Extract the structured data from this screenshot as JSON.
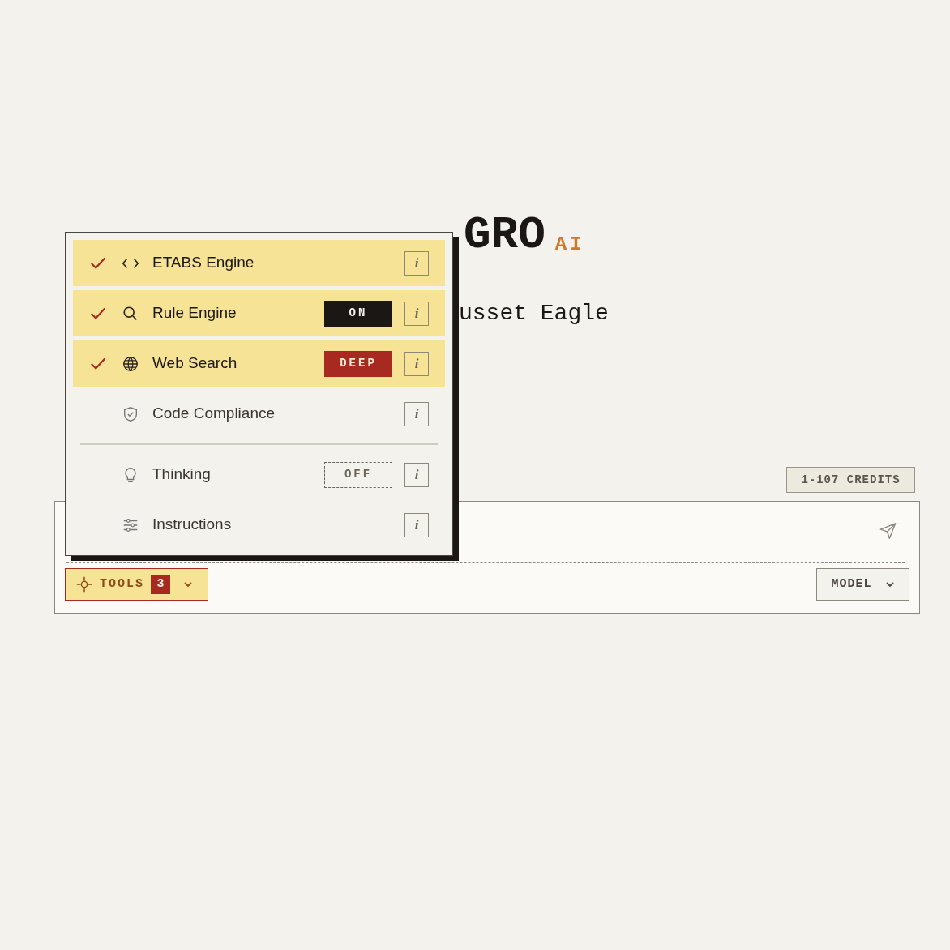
{
  "header": {
    "title": "GRO",
    "suffix": "AI",
    "subtitle": "usset Eagle"
  },
  "credits": "1-107 CREDITS",
  "tools_menu": {
    "groups": [
      [
        {
          "label": "ETABS Engine",
          "selected": true,
          "info": "i"
        },
        {
          "label": "Rule Engine",
          "selected": true,
          "badge": {
            "text": "ON",
            "kind": "dark"
          },
          "info": "i"
        },
        {
          "label": "Web Search",
          "selected": true,
          "badge": {
            "text": "DEEP",
            "kind": "accent"
          },
          "info": "i"
        },
        {
          "label": "Code Compliance",
          "selected": false,
          "info": "i"
        }
      ],
      [
        {
          "label": "Thinking",
          "selected": false,
          "badge": {
            "text": "OFF",
            "kind": "dashed"
          },
          "info": "i"
        },
        {
          "label": "Instructions",
          "selected": false,
          "info": "i"
        }
      ]
    ]
  },
  "composer": {
    "tools_button": {
      "label": "TOOLS",
      "count": "3",
      "expanded": true
    },
    "model_button": {
      "label": "MODEL"
    }
  }
}
